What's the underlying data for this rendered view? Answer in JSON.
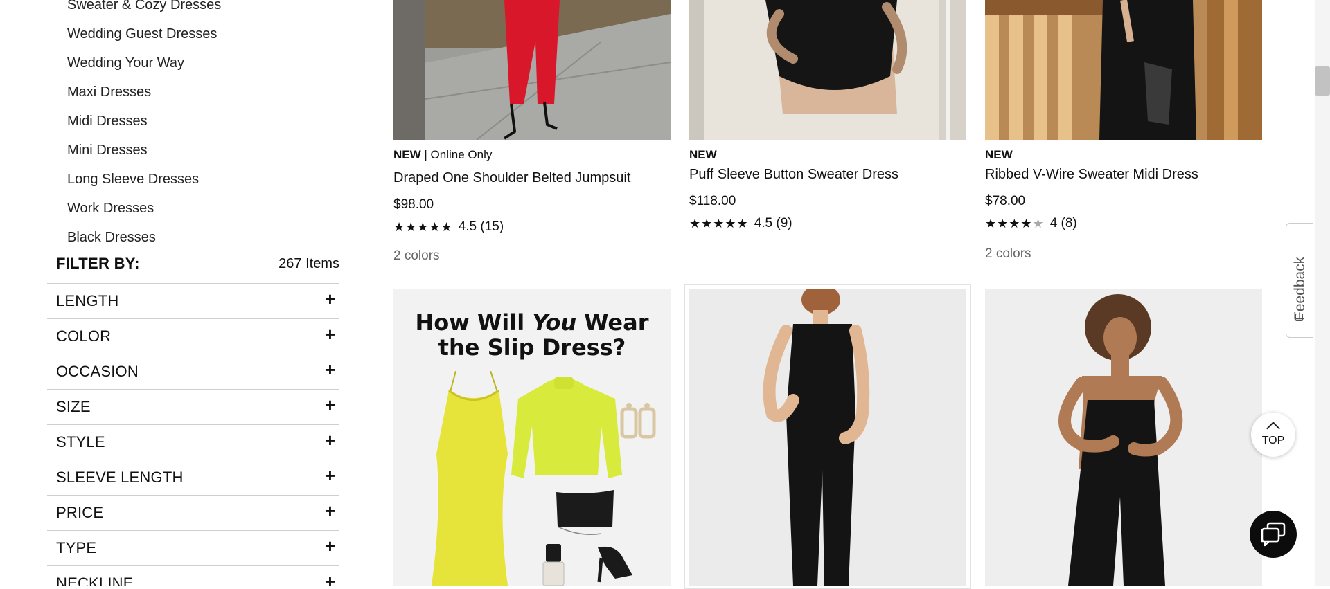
{
  "sidebar": {
    "categories": [
      "Sweater & Cozy Dresses",
      "Wedding Guest Dresses",
      "Wedding Your Way",
      "Maxi Dresses",
      "Midi Dresses",
      "Mini Dresses",
      "Long Sleeve Dresses",
      "Work Dresses",
      "Black Dresses"
    ],
    "filter_title": "FILTER BY:",
    "item_count": "267 Items",
    "facets": [
      "LENGTH",
      "COLOR",
      "OCCASION",
      "SIZE",
      "STYLE",
      "SLEEVE LENGTH",
      "PRICE",
      "TYPE",
      "NECKLINE"
    ],
    "expand_symbol": "+"
  },
  "products": [
    {
      "badge_new": "NEW",
      "badge_extra": " | Online Only",
      "name": "Draped One Shoulder Belted Jumpsuit",
      "price": "$98.00",
      "stars": "★★★★★",
      "stars_off": "",
      "rating": "4.5 (15)",
      "colors": "2 colors"
    },
    {
      "badge_new": "NEW",
      "badge_extra": "",
      "name": "Puff Sleeve Button Sweater Dress",
      "price": "$118.00",
      "stars": "★★★★★",
      "stars_off": "",
      "rating": "4.5 (9)",
      "colors": ""
    },
    {
      "badge_new": "NEW",
      "badge_extra": "",
      "name": "Ribbed V-Wire Sweater Midi Dress",
      "price": "$78.00",
      "stars": "★★★★",
      "stars_off": "★",
      "rating": "4 (8)",
      "colors": "2 colors"
    }
  ],
  "promo": {
    "line1a": "How Will ",
    "line1b": "You",
    "line1c": " Wear",
    "line2": "the Slip Dress?"
  },
  "widgets": {
    "feedback": "Feedback",
    "top": "TOP"
  },
  "colors": {
    "accent_yellow": "#e6e33a",
    "sweater_lime": "#d8ea3c",
    "jumpsuit_red": "#d8182a",
    "text": "#111111",
    "muted": "#666666"
  }
}
